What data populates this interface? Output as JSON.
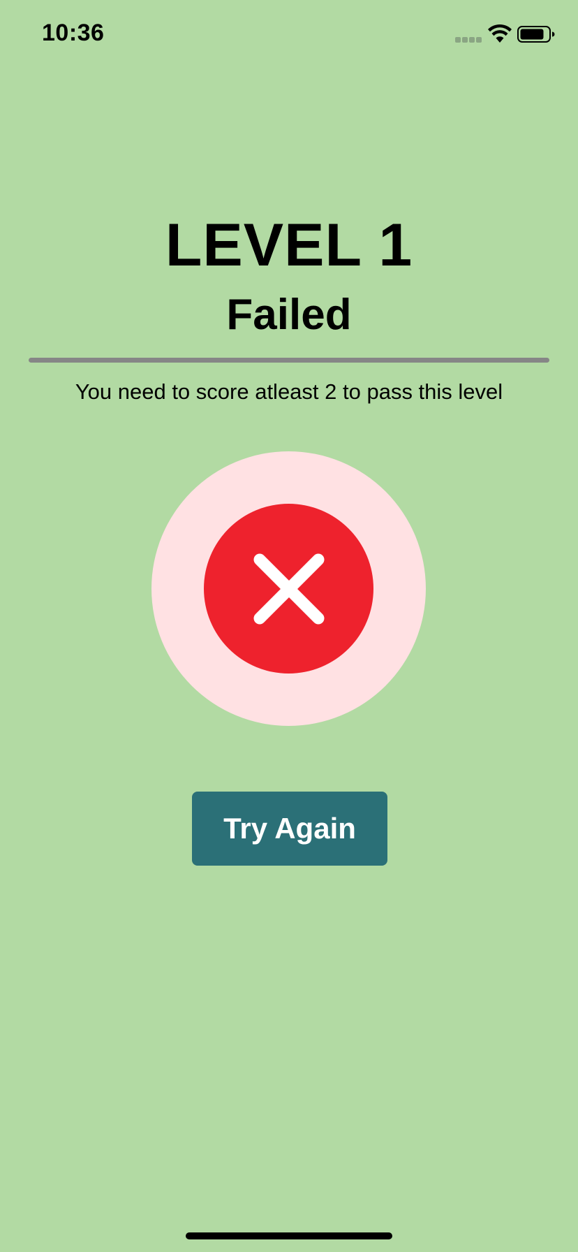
{
  "status_bar": {
    "time": "10:36",
    "icons": [
      "signal-icon",
      "wifi-icon",
      "battery-icon"
    ]
  },
  "result": {
    "level_title": "LEVEL 1",
    "status": "Failed",
    "requirement_text": "You need to score atleast 2 to pass this level",
    "icon": "close-icon"
  },
  "actions": {
    "try_again_label": "Try Again"
  },
  "colors": {
    "background": "#b2daa3",
    "divider": "#868686",
    "outer_circle": "#ffe1e3",
    "inner_circle": "#ee222d",
    "button": "#2b7077",
    "button_text": "#ffffff"
  }
}
